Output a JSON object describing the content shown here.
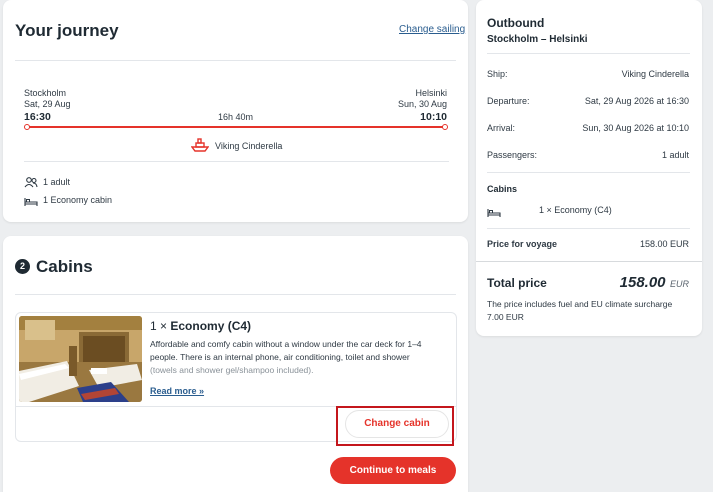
{
  "journey": {
    "title": "Your journey",
    "change_link": "Change sailing",
    "from": {
      "city": "Stockholm",
      "date": "Sat, 29 Aug",
      "time": "16:30"
    },
    "to": {
      "city": "Helsinki",
      "date": "Sun, 30 Aug",
      "time": "10:10"
    },
    "duration": "16h 40m",
    "ship": "Viking Cinderella",
    "passengers": "1 adult",
    "cabin_summary": "1 Economy cabin"
  },
  "cabins": {
    "step_number": "2",
    "title": "Cabins",
    "cabin": {
      "quantity": "1 ×",
      "name": "Economy (C4)",
      "description_1": "Affordable and comfy cabin without a window under the car deck for 1–4",
      "description_2": "people. There is an internal phone, air conditioning, toilet and shower",
      "description_3": "(towels and shower gel/shampoo included).",
      "read_more": "Read more »"
    },
    "change_button": "Change cabin",
    "continue_button": "Continue to meals"
  },
  "summary": {
    "direction": "Outbound",
    "route": "Stockholm – Helsinki",
    "rows": [
      {
        "label": "Ship:",
        "value": "Viking Cinderella"
      },
      {
        "label": "Departure:",
        "value": "Sat, 29 Aug 2026 at 16:30"
      },
      {
        "label": "Arrival:",
        "value": "Sun, 30 Aug 2026 at 10:10"
      },
      {
        "label": "Passengers:",
        "value": "1 adult"
      }
    ],
    "cabins_label": "Cabins",
    "cabin_line": "1 × Economy (C4)",
    "price_label": "Price for voyage",
    "price_value": "158.00 EUR",
    "total_label": "Total price",
    "total_value": "158.00",
    "currency": "EUR",
    "note_1": "The price includes fuel and EU climate surcharge",
    "note_2": "7.00 EUR"
  },
  "colors": {
    "accent": "#e5332a",
    "link": "#2a5d8f",
    "highlight": "#c4161c"
  }
}
